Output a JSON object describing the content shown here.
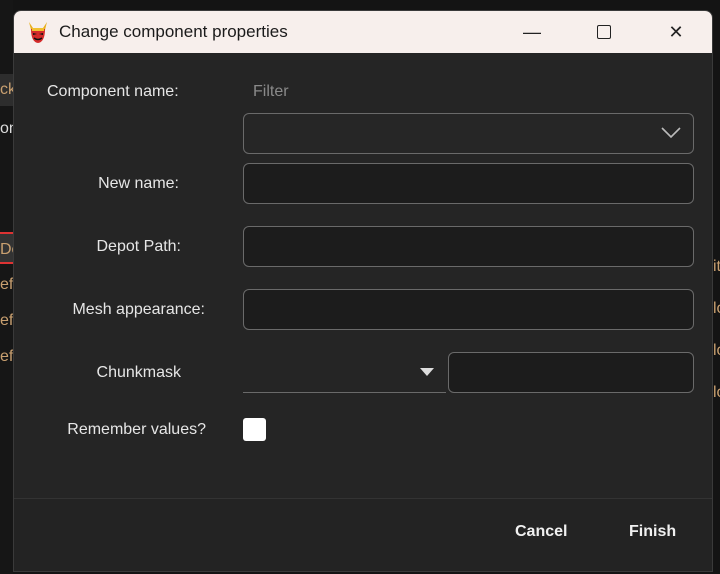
{
  "background": {
    "left_fragments": [
      "ck",
      "on",
      "De",
      "ef",
      "ef",
      "ef"
    ],
    "right_fragments": [
      "it",
      "lo",
      "lo",
      "lo"
    ]
  },
  "window": {
    "title": "Change component properties",
    "minimize": "—",
    "maximize": "☐",
    "close": "✕"
  },
  "form": {
    "component_name_label": "Component name:",
    "filter_placeholder": "Filter",
    "component_select_value": "",
    "new_name_label": "New name:",
    "new_name_value": "",
    "depot_path_label": "Depot Path:",
    "depot_path_value": "",
    "mesh_appearance_label": "Mesh appearance:",
    "mesh_appearance_value": "",
    "chunkmask_label": "Chunkmask",
    "chunkmask_value": "",
    "remember_label": "Remember values?",
    "remember_checked": false
  },
  "footer": {
    "cancel": "Cancel",
    "finish": "Finish"
  }
}
